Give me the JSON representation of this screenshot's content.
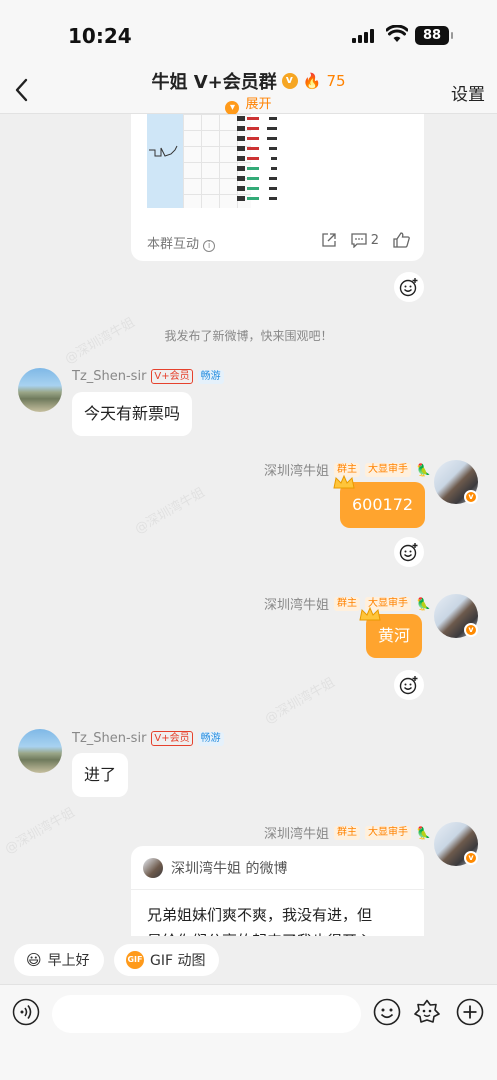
{
  "status_bar": {
    "time": "10:24",
    "battery": "88"
  },
  "header": {
    "back_icon": "chevron-left-icon",
    "title": "牛姐 V+会员群",
    "fire_count": "75",
    "expand_label": "展开",
    "settings_label": "设置"
  },
  "post_card": {
    "footer_label": "本群互动",
    "comment_count": "2"
  },
  "system_message": "我发布了新微博，快来围观吧！",
  "messages": [
    {
      "sender": "Tz_Shen-sir",
      "badges": [
        "V+会员",
        "畅游"
      ],
      "text": "今天有新票吗",
      "direction": "in"
    },
    {
      "sender": "深圳湾牛姐",
      "badges": [
        "群主",
        "大显审手"
      ],
      "text": "600172",
      "direction": "out"
    },
    {
      "sender": "深圳湾牛姐",
      "badges": [
        "群主",
        "大显审手"
      ],
      "text": "黄河",
      "direction": "out"
    },
    {
      "sender": "Tz_Shen-sir",
      "badges": [
        "V+会员",
        "畅游"
      ],
      "text": "进了",
      "direction": "in"
    },
    {
      "sender": "深圳湾牛姐",
      "badges": [
        "群主",
        "大显审手"
      ],
      "direction": "out"
    }
  ],
  "shared_weibo": {
    "header": "深圳湾牛姐 的微博",
    "body_line1": "兄弟姐妹们爽不爽，我没有进，但",
    "body_line2": "是给你们分享的起来了我也得开心"
  },
  "quick_replies": [
    {
      "label": "早上好",
      "icon": "smile-emoji-icon"
    },
    {
      "label": "GIF 动图",
      "icon": "gif-icon"
    }
  ],
  "input_bar": {
    "placeholder": "",
    "voice_icon": "voice-icon",
    "emoji_icon": "emoji-icon",
    "sticker_icon": "sticker-icon",
    "plus_icon": "plus-icon"
  },
  "colors": {
    "accent": "#ff8200",
    "bubble_out": "#ffa42e",
    "background": "#efefef"
  }
}
